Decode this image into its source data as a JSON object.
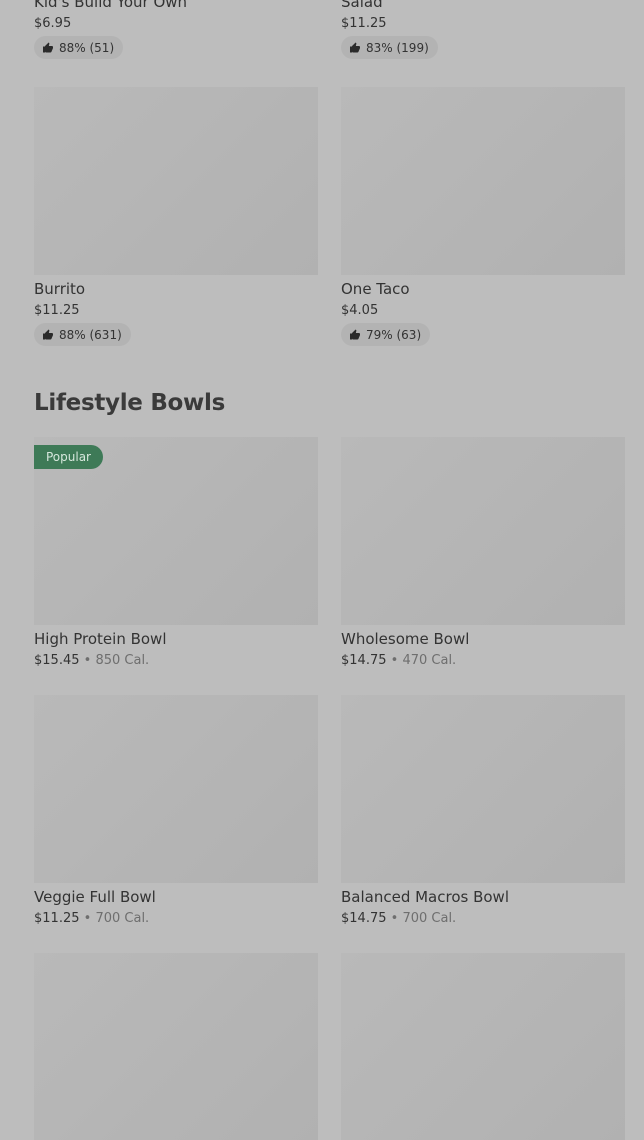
{
  "top_items": [
    {
      "name": "Kid's Build Your Own",
      "price": "$6.95",
      "rating": "88% (51)"
    },
    {
      "name": "Salad",
      "price": "$11.25",
      "rating": "83% (199)"
    },
    {
      "name": "Burrito",
      "price": "$11.25",
      "rating": "88% (631)"
    },
    {
      "name": "One Taco",
      "price": "$4.05",
      "rating": "79% (63)"
    }
  ],
  "lifestyle": {
    "title": "Lifestyle Bowls",
    "badge": "Popular",
    "separator": "•",
    "items": [
      {
        "name": "High Protein Bowl",
        "price": "$15.45",
        "calories": "850 Cal."
      },
      {
        "name": "Wholesome Bowl",
        "price": "$14.75",
        "calories": "470 Cal."
      },
      {
        "name": "Veggie Full Bowl",
        "price": "$11.25",
        "calories": "700 Cal."
      },
      {
        "name": "Balanced Macros Bowl",
        "price": "$14.75",
        "calories": "700 Cal."
      }
    ]
  },
  "icons": {
    "rating": "thumbs-up-icon"
  },
  "colors": {
    "background": "#bdbdbd",
    "badge": "#3e7a57",
    "image_placeholder": "#b5b5b5"
  }
}
